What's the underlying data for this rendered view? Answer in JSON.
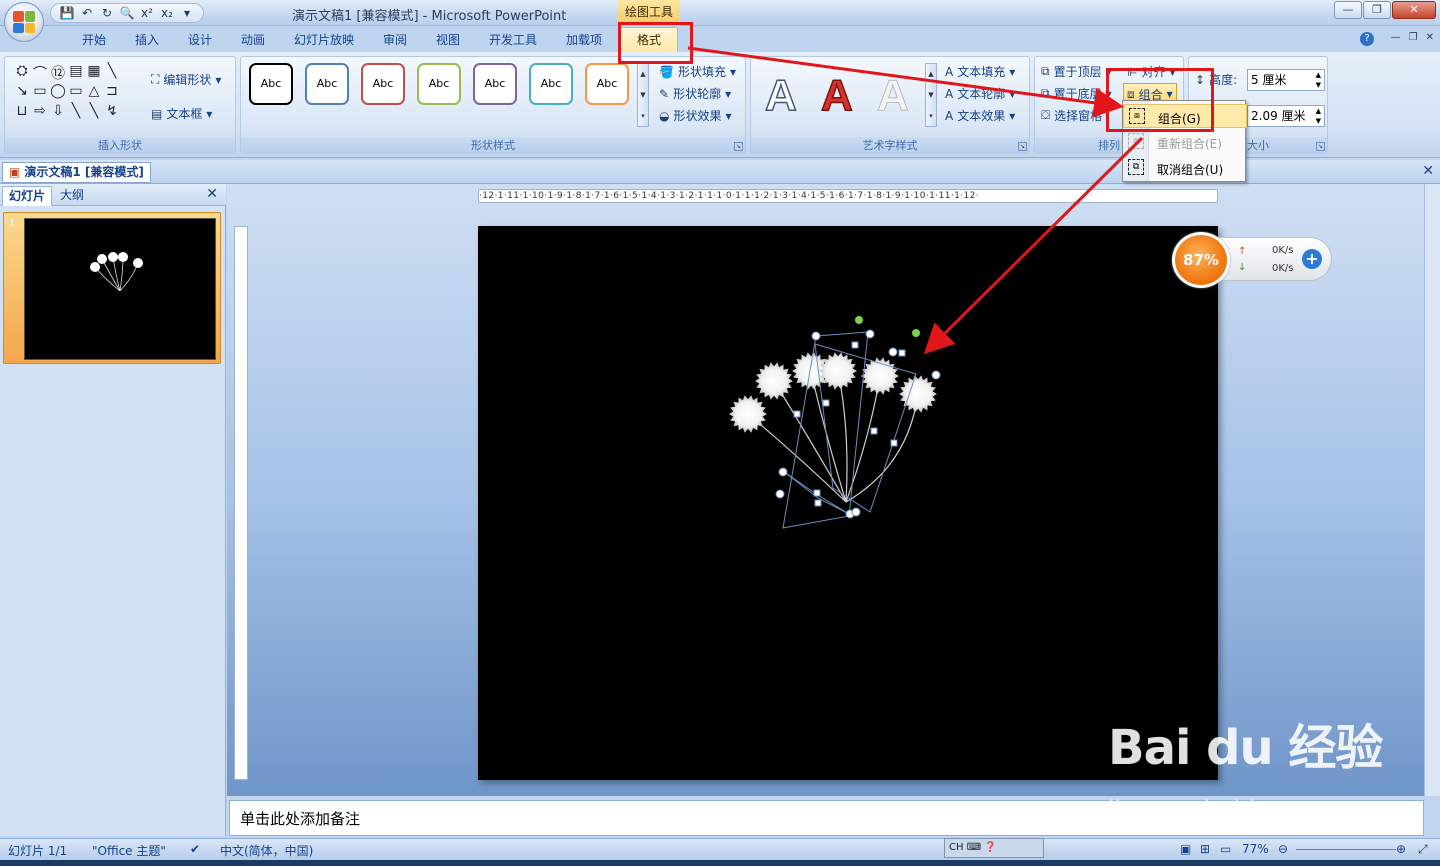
{
  "window": {
    "title": "演示文稿1 [兼容模式] - Microsoft PowerPoint",
    "context_tab_group": "绘图工具",
    "qat_icons": [
      "save-icon",
      "undo-icon",
      "redo-icon",
      "print-preview-icon",
      "superscript-icon",
      "subscript-icon"
    ],
    "qat_superscript": "x²",
    "qat_subscript": "x₂"
  },
  "tabs": [
    "开始",
    "插入",
    "设计",
    "动画",
    "幻灯片放映",
    "审阅",
    "视图",
    "开发工具",
    "加载项",
    "格式"
  ],
  "active_tab": "格式",
  "ribbon": {
    "insert_shapes": {
      "label": "插入形状",
      "edit_shape": "编辑形状",
      "text_box": "文本框",
      "shape_glyphs": [
        "⛭",
        "⌒",
        "⑫",
        "▤",
        "▦",
        "╲",
        "",
        "↘",
        "▭",
        "◯",
        "▭",
        "△",
        "⊐",
        "",
        "⊔",
        "⇨",
        "⇩",
        "╲",
        "╲",
        "↯",
        ""
      ]
    },
    "shape_styles": {
      "label": "形状样式",
      "items": [
        {
          "text": "Abc",
          "color": "#000000"
        },
        {
          "text": "Abc",
          "color": "#4f81bd"
        },
        {
          "text": "Abc",
          "color": "#c0504d"
        },
        {
          "text": "Abc",
          "color": "#9bbb59"
        },
        {
          "text": "Abc",
          "color": "#8064a2"
        },
        {
          "text": "Abc",
          "color": "#4bacc6"
        },
        {
          "text": "Abc",
          "color": "#f79646"
        }
      ],
      "fill": "形状填充",
      "outline": "形状轮廓",
      "effects": "形状效果"
    },
    "wordart": {
      "label": "艺术字样式",
      "glyph": "A",
      "text_fill": "文本填充",
      "text_outline": "文本轮廓",
      "text_effects": "文本效果"
    },
    "arrange": {
      "label": "排列",
      "bring_front": "置于顶层",
      "send_back": "置于底层",
      "selection_pane": "选择窗格",
      "align": "对齐",
      "group": "组合"
    },
    "size": {
      "label": "大小",
      "height_label": "高度:",
      "height_value": "5 厘米",
      "width_value": "2.09 厘米"
    }
  },
  "dropdown": {
    "items": [
      {
        "label": "组合(G)",
        "enabled": true
      },
      {
        "label": "重新组合(E)",
        "enabled": false
      },
      {
        "label": "取消组合(U)",
        "enabled": true
      }
    ]
  },
  "document_tab": "演示文稿1 [兼容模式]",
  "left_pane": {
    "tabs": [
      "幻灯片",
      "大纲"
    ],
    "slide_number": "1"
  },
  "ruler": {
    "h_text": "·12·1·11·1·10·1·9·1·8·1·7·1·6·1·5·1·4·1·3·1·2·1·1·1·0·1·1·1·2·1·3·1·4·1·5·1·6·1·7·1·8·1·9·1·10·1·11·1·12·"
  },
  "speed_widget": {
    "percent": "87%",
    "up": "0K/s",
    "down": "0K/s"
  },
  "notes_placeholder": "单击此处添加备注",
  "status_bar": {
    "slide": "幻灯片 1/1",
    "theme": "\"Office 主题\"",
    "language": "中文(简体，中国)",
    "zoom": "77%",
    "ime": "CH"
  },
  "watermark": {
    "brand": "Bai du 经验",
    "url": "jingyan.baidu.com"
  },
  "colors": {
    "annotation_red": "#e0161a",
    "ribbon_blue": "#15428b",
    "active_tab": "#fde9a8"
  }
}
